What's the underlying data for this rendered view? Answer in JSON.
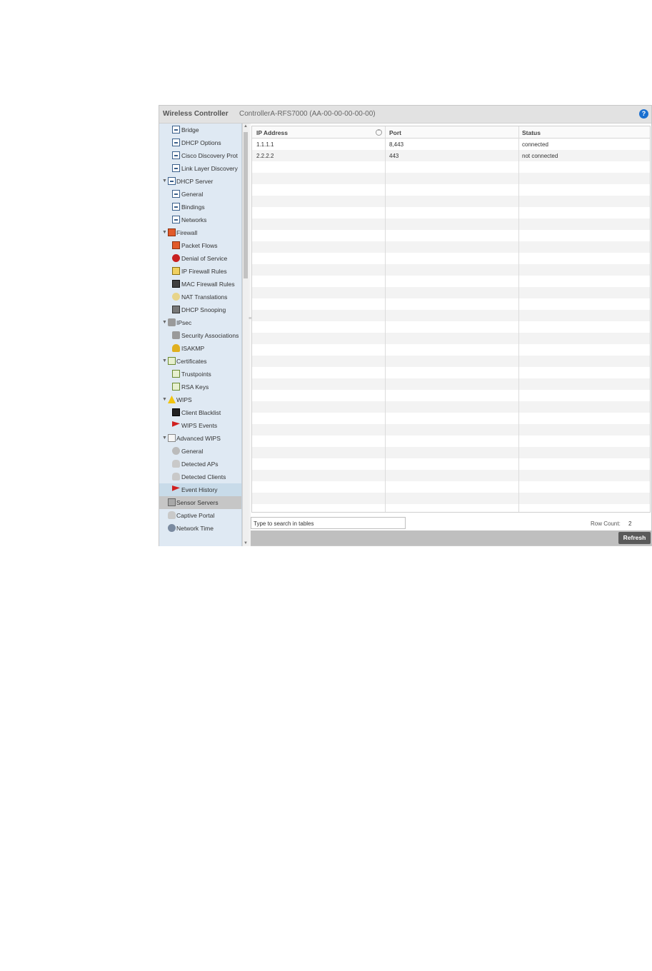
{
  "header": {
    "app_title": "Wireless Controller",
    "device": "ControllerA-RFS7000 (AA-00-00-00-00-00)",
    "help": "?"
  },
  "sidebar": {
    "items": [
      {
        "label": "Bridge",
        "icon": "network-icon",
        "level": 2,
        "toggle": ""
      },
      {
        "label": "DHCP Options",
        "icon": "network-icon",
        "level": 2,
        "toggle": ""
      },
      {
        "label": "Cisco Discovery Prot",
        "icon": "network-icon",
        "level": 2,
        "toggle": ""
      },
      {
        "label": "Link Layer Discovery",
        "icon": "network-icon",
        "level": 2,
        "toggle": ""
      },
      {
        "label": "DHCP Server",
        "icon": "network-icon",
        "level": 1,
        "toggle": "▼"
      },
      {
        "label": "General",
        "icon": "network-icon",
        "level": 2,
        "toggle": ""
      },
      {
        "label": "Bindings",
        "icon": "network-icon",
        "level": 2,
        "toggle": ""
      },
      {
        "label": "Networks",
        "icon": "network-icon",
        "level": 2,
        "toggle": ""
      },
      {
        "label": "Firewall",
        "icon": "firewall-icon",
        "level": 1,
        "toggle": "▼"
      },
      {
        "label": "Packet Flows",
        "icon": "firewall-icon",
        "level": 2,
        "toggle": ""
      },
      {
        "label": "Denial of Service",
        "icon": "denial-icon",
        "level": 2,
        "toggle": ""
      },
      {
        "label": "IP Firewall Rules",
        "icon": "ip-rules-icon",
        "level": 2,
        "toggle": ""
      },
      {
        "label": "MAC Firewall Rules",
        "icon": "mac-rules-icon",
        "level": 2,
        "toggle": ""
      },
      {
        "label": "NAT Translations",
        "icon": "nat-icon",
        "level": 2,
        "toggle": ""
      },
      {
        "label": "DHCP Snooping",
        "icon": "snooping-icon",
        "level": 2,
        "toggle": ""
      },
      {
        "label": "IPsec",
        "icon": "lock-icon",
        "level": 1,
        "toggle": "▼"
      },
      {
        "label": "Security Associations",
        "icon": "lock-icon",
        "level": 2,
        "toggle": ""
      },
      {
        "label": "ISAKMP",
        "icon": "key-icon",
        "level": 2,
        "toggle": ""
      },
      {
        "label": "Certificates",
        "icon": "certificate-icon",
        "level": 1,
        "toggle": "▼"
      },
      {
        "label": "Trustpoints",
        "icon": "certificate-icon",
        "level": 2,
        "toggle": ""
      },
      {
        "label": "RSA Keys",
        "icon": "certificate-icon",
        "level": 2,
        "toggle": ""
      },
      {
        "label": "WIPS",
        "icon": "warning-icon",
        "level": 1,
        "toggle": "▼"
      },
      {
        "label": "Client Blacklist",
        "icon": "blacklist-icon",
        "level": 2,
        "toggle": ""
      },
      {
        "label": "WIPS Events",
        "icon": "flag-icon",
        "level": 2,
        "toggle": ""
      },
      {
        "label": "Advanced WIPS",
        "icon": "document-icon",
        "level": 1,
        "toggle": "▼"
      },
      {
        "label": "General",
        "icon": "gear-icon",
        "level": 2,
        "toggle": ""
      },
      {
        "label": "Detected APs",
        "icon": "access-point-icon",
        "level": 2,
        "toggle": ""
      },
      {
        "label": "Detected Clients",
        "icon": "access-point-icon",
        "level": 2,
        "toggle": ""
      },
      {
        "label": "Event History",
        "icon": "flag-icon",
        "level": 2,
        "toggle": "",
        "state": "selected"
      },
      {
        "label": "Sensor Servers",
        "icon": "server-icon",
        "level": 1,
        "toggle": "",
        "state": "active"
      },
      {
        "label": "Captive Portal",
        "icon": "access-point-icon",
        "level": 1,
        "toggle": ""
      },
      {
        "label": "Network Time",
        "icon": "globe-icon",
        "level": 1,
        "toggle": ""
      }
    ]
  },
  "table": {
    "columns": [
      "IP Address",
      "Port",
      "Status"
    ],
    "rows": [
      [
        "1.1.1.1",
        "8,443",
        "connected"
      ],
      [
        "2.2.2.2",
        "443",
        "not connected"
      ]
    ],
    "empty_row_count": 32
  },
  "search": {
    "placeholder": "Type to search in tables"
  },
  "row_count": {
    "label": "Row Count:",
    "value": "2"
  },
  "footer": {
    "refresh_label": "Refresh"
  }
}
